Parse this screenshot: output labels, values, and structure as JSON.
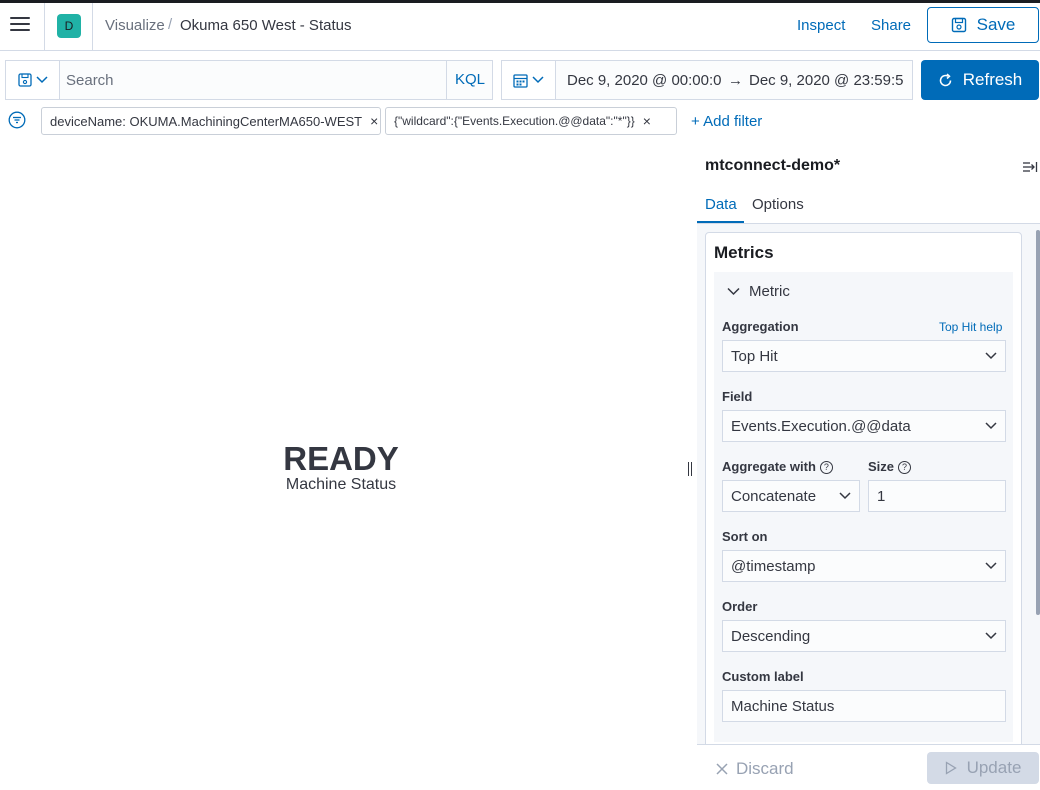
{
  "header": {
    "avatar_initial": "D",
    "breadcrumb_app": "Visualize",
    "breadcrumb_separator": "/",
    "breadcrumb_page": "Okuma 650 West - Status",
    "inspect_label": "Inspect",
    "share_label": "Share",
    "save_label": "Save"
  },
  "query": {
    "placeholder": "Search",
    "language": "KQL"
  },
  "time": {
    "start": "Dec 9, 2020 @ 00:00:0",
    "arrow": "→",
    "end": "Dec 9, 2020 @ 23:59:5",
    "refresh_label": "Refresh"
  },
  "filters": {
    "items": [
      {
        "label": "deviceName: OKUMA.MachiningCenterMA650-WEST"
      },
      {
        "label": "{\"wildcard\":{\"Events.Execution.@@data\":\"*\"}}"
      }
    ],
    "remove_symbol": "×",
    "add_label": "+ Add filter"
  },
  "visualization": {
    "value": "READY",
    "label": "Machine Status"
  },
  "sidebar": {
    "index_pattern": "mtconnect-demo*",
    "tabs": [
      {
        "label": "Data"
      },
      {
        "label": "Options"
      }
    ],
    "metrics_title": "Metrics",
    "metric_accordion_label": "Metric",
    "aggregation": {
      "label": "Aggregation",
      "help_link": "Top Hit help",
      "value": "Top Hit"
    },
    "field": {
      "label": "Field",
      "value": "Events.Execution.@@data"
    },
    "aggregate_with": {
      "label": "Aggregate with",
      "value": "Concatenate"
    },
    "size": {
      "label": "Size",
      "value": "1"
    },
    "sort_on": {
      "label": "Sort on",
      "value": "@timestamp"
    },
    "order": {
      "label": "Order",
      "value": "Descending"
    },
    "custom_label": {
      "label": "Custom label",
      "value": "Machine Status"
    },
    "discard_label": "Discard",
    "update_label": "Update"
  },
  "colors": {
    "primary": "#006bb8",
    "avatar": "#20b2a6",
    "border": "#d3dae6"
  }
}
